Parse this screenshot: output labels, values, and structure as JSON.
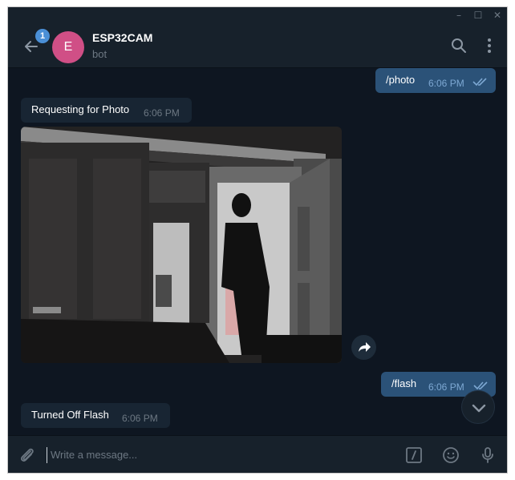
{
  "window": {
    "minimize": "–",
    "maximize": "☐",
    "close": "✕"
  },
  "header": {
    "unread_count": "1",
    "avatar_letter": "E",
    "chat_name": "ESP32CAM",
    "chat_status": "bot"
  },
  "messages": [
    {
      "direction": "out",
      "text": "/photo",
      "time": "6:06 PM",
      "read": true
    },
    {
      "direction": "in",
      "text": "Requesting for Photo",
      "time": "6:06 PM"
    },
    {
      "direction": "in",
      "type": "photo",
      "description_icon": "photo-message"
    },
    {
      "direction": "out",
      "text": "/flash",
      "time": "6:06 PM",
      "read": true
    },
    {
      "direction": "in",
      "text": "Turned Off Flash",
      "time": "6:06 PM"
    }
  ],
  "composer": {
    "placeholder": "Write a message..."
  },
  "icons": {
    "back": "arrow-left-icon",
    "search": "search-icon",
    "menu": "more-vertical-icon",
    "share": "share-icon",
    "scroll_down": "chevron-down-icon",
    "attach": "paperclip-icon",
    "command": "slash-command-icon",
    "emoji": "emoji-icon",
    "mic": "microphone-icon"
  },
  "colors": {
    "background": "#0e1621",
    "panel": "#17212b",
    "outgoing_bubble": "#2b5278",
    "incoming_bubble": "#182533",
    "accent": "#4a8fd6",
    "avatar": "#d04f86"
  }
}
